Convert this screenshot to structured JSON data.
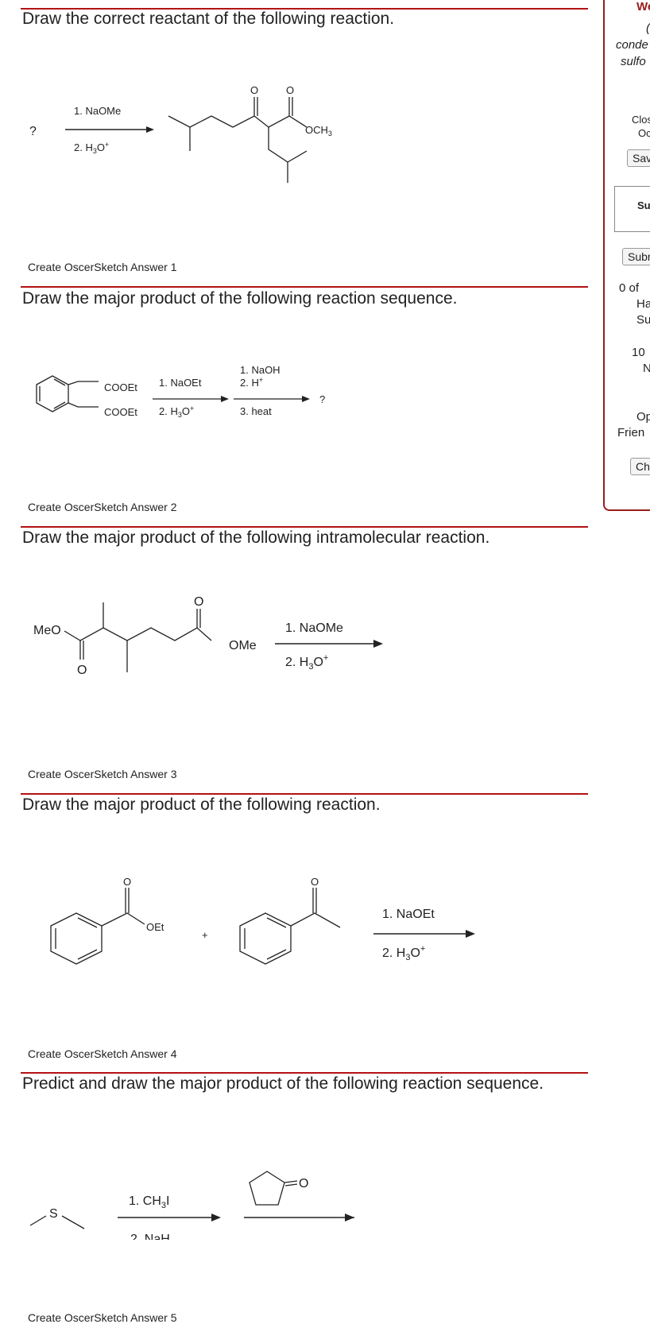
{
  "questions": [
    {
      "title": "Draw the correct reactant of the following reaction.",
      "create": "Create OscerSketch Answer 1"
    },
    {
      "title": "Draw the major product of the following reaction sequence.",
      "create": "Create OscerSketch Answer 2"
    },
    {
      "title": "Draw the major product of the following intramolecular reaction.",
      "create": "Create OscerSketch Answer 3"
    },
    {
      "title": "Draw the major product of the following reaction.",
      "create": "Create OscerSketch Answer 4"
    },
    {
      "title": "Predict and draw the major product of the following reaction sequence.",
      "create": "Create OscerSketch Answer 5"
    }
  ],
  "scheme1": {
    "unknown": "?",
    "reagent1": "1. NaOMe",
    "reagent2": "2. H3O+",
    "o1": "O",
    "o2": "O",
    "och3": "OCH3"
  },
  "scheme2": {
    "cooet1": "COOEt",
    "cooet2": "COOEt",
    "a1": "1. NaOEt",
    "a2": "2. H3O+",
    "b1": "1. NaOH",
    "b2": "2. H+",
    "b3": "3. heat",
    "unknown": "?"
  },
  "scheme3": {
    "meo": "MeO",
    "o_bottom": "O",
    "o_top": "O",
    "ome": "OMe",
    "r1": "1. NaOMe",
    "r2": "2. H3O+"
  },
  "scheme4": {
    "o1": "O",
    "oet": "OEt",
    "plus": "+",
    "o2": "O",
    "r1": "1. NaOEt",
    "r2": "2. H3O+"
  },
  "scheme5": {
    "s": "S",
    "r1": "1. CH3I",
    "r2": "2. NaH",
    "o": "O"
  },
  "sidebar": {
    "header": "We",
    "line1": "(",
    "line2": "conde",
    "line3": "sulfo",
    "close": "Clos",
    "close2": "Oc",
    "save_btn": "Sav",
    "su": "Su",
    "submit_btn": "Subr",
    "count": "0 of",
    "h": "Ha",
    "s": "Su",
    "ten": "10",
    "n": "N",
    "op": "Op",
    "friend": "Frien",
    "ch_btn": "Ch"
  },
  "colors": {
    "accent": "#b31212"
  }
}
